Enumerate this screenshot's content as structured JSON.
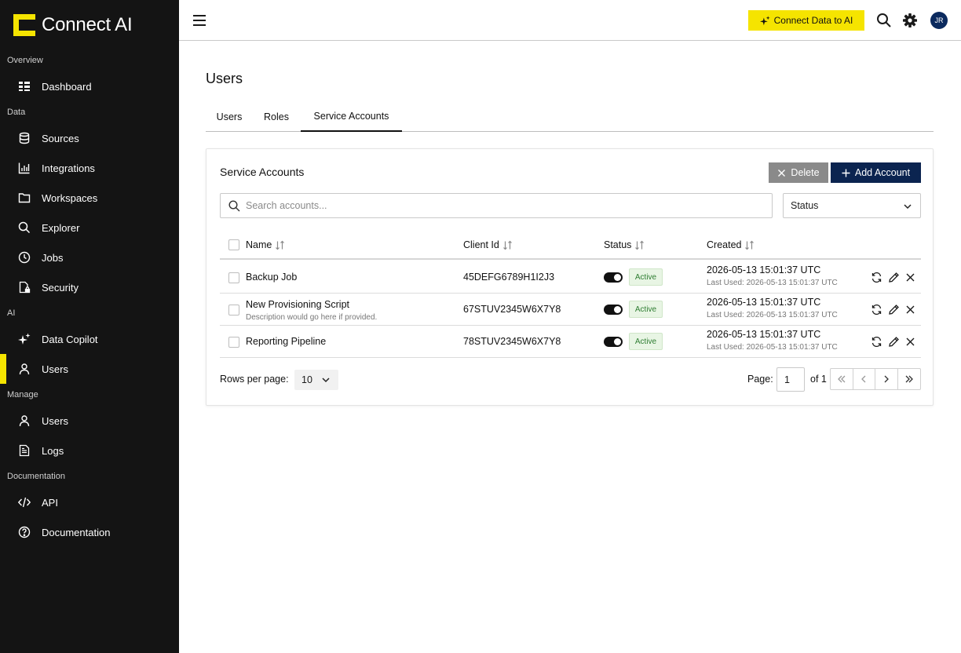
{
  "app": {
    "name": "Connect AI",
    "accent": "#f5e400",
    "sidebar_bg": "#141414",
    "primary": "#0b2450"
  },
  "sidebar": {
    "sections": [
      {
        "label": "Overview"
      },
      {
        "label": "Data"
      },
      {
        "label": "AI"
      },
      {
        "label": "Manage"
      },
      {
        "label": "Documentation"
      }
    ],
    "items": [
      {
        "label": "Dashboard",
        "icon": "dashboard-icon"
      },
      {
        "label": "Sources",
        "icon": "database-icon"
      },
      {
        "label": "Integrations",
        "icon": "bar-chart-icon"
      },
      {
        "label": "Workspaces",
        "icon": "folder-icon"
      },
      {
        "label": "Explorer",
        "icon": "search-icon"
      },
      {
        "label": "Jobs",
        "icon": "clock-icon"
      },
      {
        "label": "Security",
        "icon": "file-lock-icon"
      },
      {
        "label": "Data Copilot",
        "icon": "sparkle-icon"
      },
      {
        "label": "Users",
        "icon": "user-icon",
        "active": true
      },
      {
        "label": "Users",
        "icon": "user-icon"
      },
      {
        "label": "Logs",
        "icon": "document-icon"
      },
      {
        "label": "API",
        "icon": "code-icon"
      },
      {
        "label": "Documentation",
        "icon": "help-circle-icon"
      }
    ]
  },
  "topbar": {
    "cta_label": "Connect Data to AI",
    "avatar_initials": "JR"
  },
  "page": {
    "title": "Users",
    "tabs": [
      {
        "label": "Users"
      },
      {
        "label": "Roles"
      },
      {
        "label": "Service Accounts",
        "active": true
      }
    ]
  },
  "card": {
    "title": "Service Accounts",
    "delete_label": "Delete",
    "add_label": "Add Account",
    "search_placeholder": "Search accounts...",
    "status_filter": "Status",
    "columns": {
      "name": "Name",
      "client_id": "Client Id",
      "status": "Status",
      "created": "Created"
    },
    "rows": [
      {
        "name": "Backup Job",
        "description": "",
        "client_id": "45DEFG6789H1I2J3",
        "enabled": true,
        "status": "Active",
        "created": "2026-05-13 15:01:37 UTC",
        "last_used": "Last Used: 2026-05-13 15:01:37 UTC"
      },
      {
        "name": "New Provisioning Script",
        "description": "Description would go here if provided.",
        "client_id": "67STUV2345W6X7Y8",
        "enabled": true,
        "status": "Active",
        "created": "2026-05-13 15:01:37 UTC",
        "last_used": "Last Used: 2026-05-13 15:01:37 UTC"
      },
      {
        "name": "Reporting Pipeline",
        "description": "",
        "client_id": "78STUV2345W6X7Y8",
        "enabled": true,
        "status": "Active",
        "created": "2026-05-13 15:01:37 UTC",
        "last_used": "Last Used: 2026-05-13 15:01:37 UTC"
      }
    ],
    "pagination": {
      "rows_per_page_label": "Rows per page:",
      "rows_per_page": "10",
      "page_label": "Page:",
      "page": "1",
      "of_label": "of 1"
    }
  }
}
